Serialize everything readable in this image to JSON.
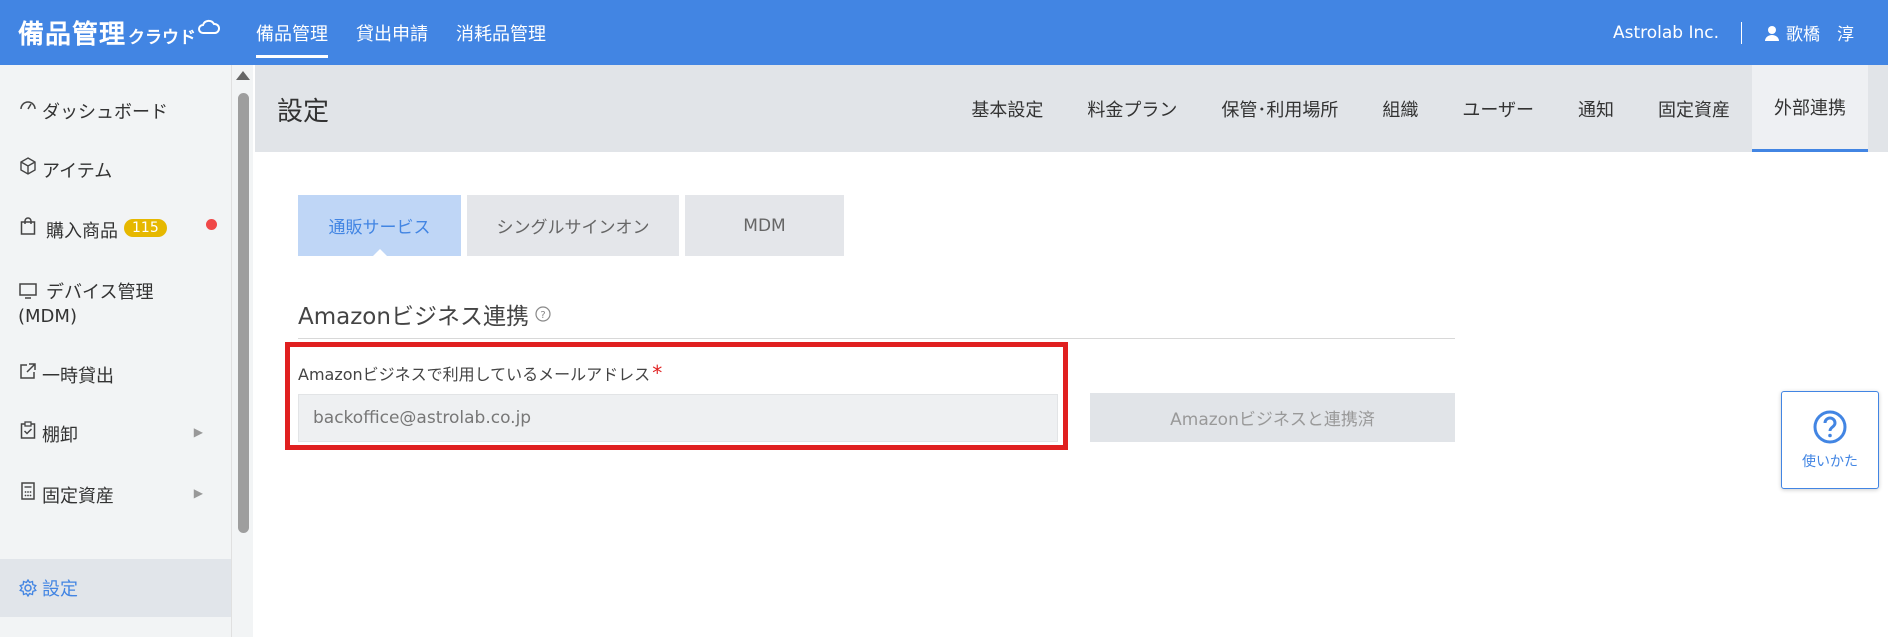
{
  "header": {
    "brand_main": "備品管理",
    "brand_sub": "クラウド",
    "nav": [
      "備品管理",
      "貸出申請",
      "消耗品管理"
    ],
    "company": "Astrolab Inc.",
    "user": "歌橋　淳"
  },
  "sidebar": {
    "items": [
      {
        "label": "ダッシュボード",
        "icon": "dashboard-icon"
      },
      {
        "label": "アイテム",
        "icon": "box-icon"
      },
      {
        "label": "購入商品",
        "icon": "shopping-bag-icon",
        "badge": "115"
      },
      {
        "label": "デバイス管理(MDM)",
        "icon": "monitor-icon"
      },
      {
        "label": "一時貸出",
        "icon": "external-link-icon"
      },
      {
        "label": "棚卸",
        "icon": "clipboard-check-icon"
      },
      {
        "label": "固定資産",
        "icon": "calculator-icon"
      },
      {
        "label": "設定",
        "icon": "gear-icon"
      }
    ],
    "device_line1": "デバイス管理",
    "device_line2": "(MDM)"
  },
  "subheader": {
    "title": "設定",
    "tabs": [
      "基本設定",
      "料金プラン",
      "保管･利用場所",
      "組織",
      "ユーザー",
      "通知",
      "固定資産",
      "外部連携"
    ],
    "active_tab": "外部連携"
  },
  "content": {
    "subtabs": [
      "通販サービス",
      "シングルサインオン",
      "MDM"
    ],
    "active_subtab": "通販サービス",
    "section_title": "Amazonビジネス連携",
    "field_label": "Amazonビジネスで利用しているメールアドレス",
    "required_mark": "*",
    "email_value": "backoffice@astrolab.co.jp",
    "linked_button": "Amazonビジネスと連携済"
  },
  "help_widget": {
    "label": "使いかた"
  },
  "colors": {
    "primary": "#4285e3",
    "required": "#e02020",
    "badge": "#e6b800"
  }
}
